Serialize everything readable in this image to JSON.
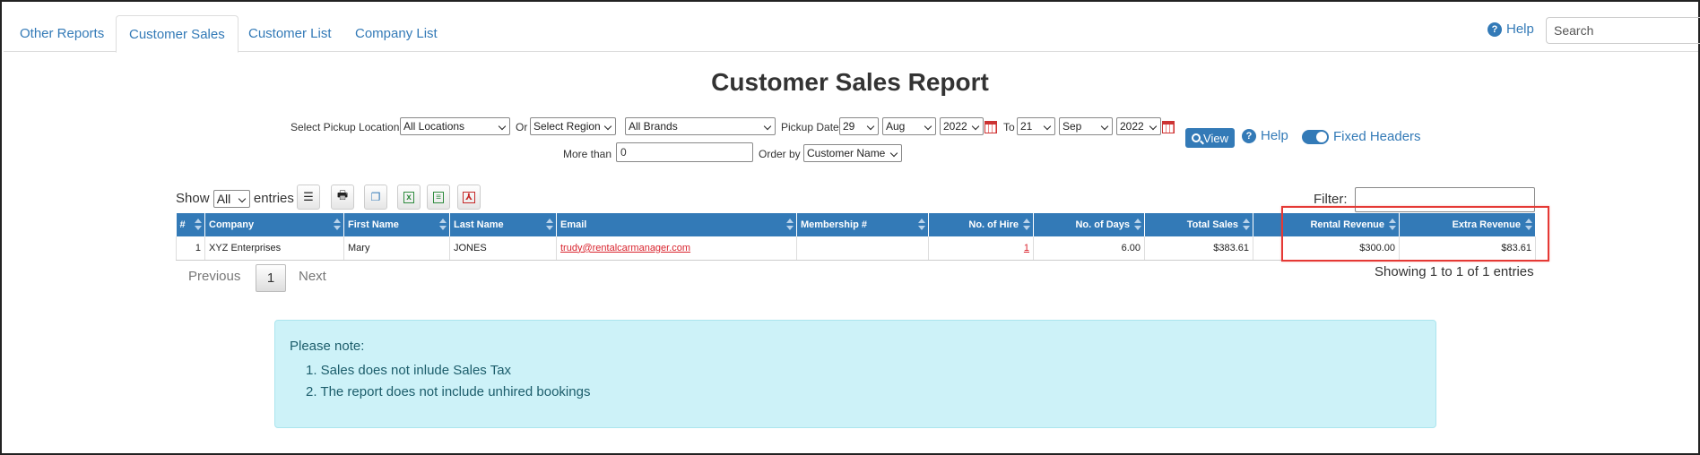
{
  "tabs": [
    "Other Reports",
    "Customer Sales",
    "Customer List",
    "Company List"
  ],
  "help_label": "Help",
  "search_placeholder": "Search",
  "page_title": "Customer Sales Report",
  "filters": {
    "pickup_location_label": "Select Pickup Location",
    "pickup_location_value": "All Locations",
    "or_label": "Or",
    "region_value": "Select Region",
    "brands_value": "All Brands",
    "pickup_date_label": "Pickup Date",
    "from_day": "29",
    "from_month": "Aug",
    "from_year": "2022",
    "to_label": "To",
    "to_day": "21",
    "to_month": "Sep",
    "to_year": "2022",
    "view_label": "View",
    "help_label": "Help",
    "fixed_headers_label": "Fixed Headers",
    "fixed_headers_on": true,
    "more_than_label": "More than",
    "more_than_value": "0",
    "order_by_label": "Order by",
    "order_by_value": "Customer Name"
  },
  "table_controls": {
    "show_label": "Show",
    "entries_value": "All",
    "entries_label": "entries",
    "filter_label": "Filter:"
  },
  "table": {
    "columns": [
      "#",
      "Company",
      "First Name",
      "Last Name",
      "Email",
      "Membership #",
      "No. of Hire",
      "No. of Days",
      "Total Sales",
      "Rental Revenue",
      "Extra Revenue"
    ],
    "rows": [
      [
        "1",
        "XYZ Enterprises",
        "Mary",
        "JONES",
        "trudy@rentalcarmanager.com",
        "",
        "1",
        "6.00",
        "$383.61",
        "$300.00",
        "$83.61"
      ]
    ]
  },
  "pagination": {
    "previous": "Previous",
    "current": "1",
    "next": "Next",
    "info": "Showing 1 to 1 of 1 entries"
  },
  "note": {
    "title": "Please note:",
    "items": [
      "1. Sales does not inlude Sales Tax",
      "2. The report does not include unhired bookings"
    ]
  }
}
